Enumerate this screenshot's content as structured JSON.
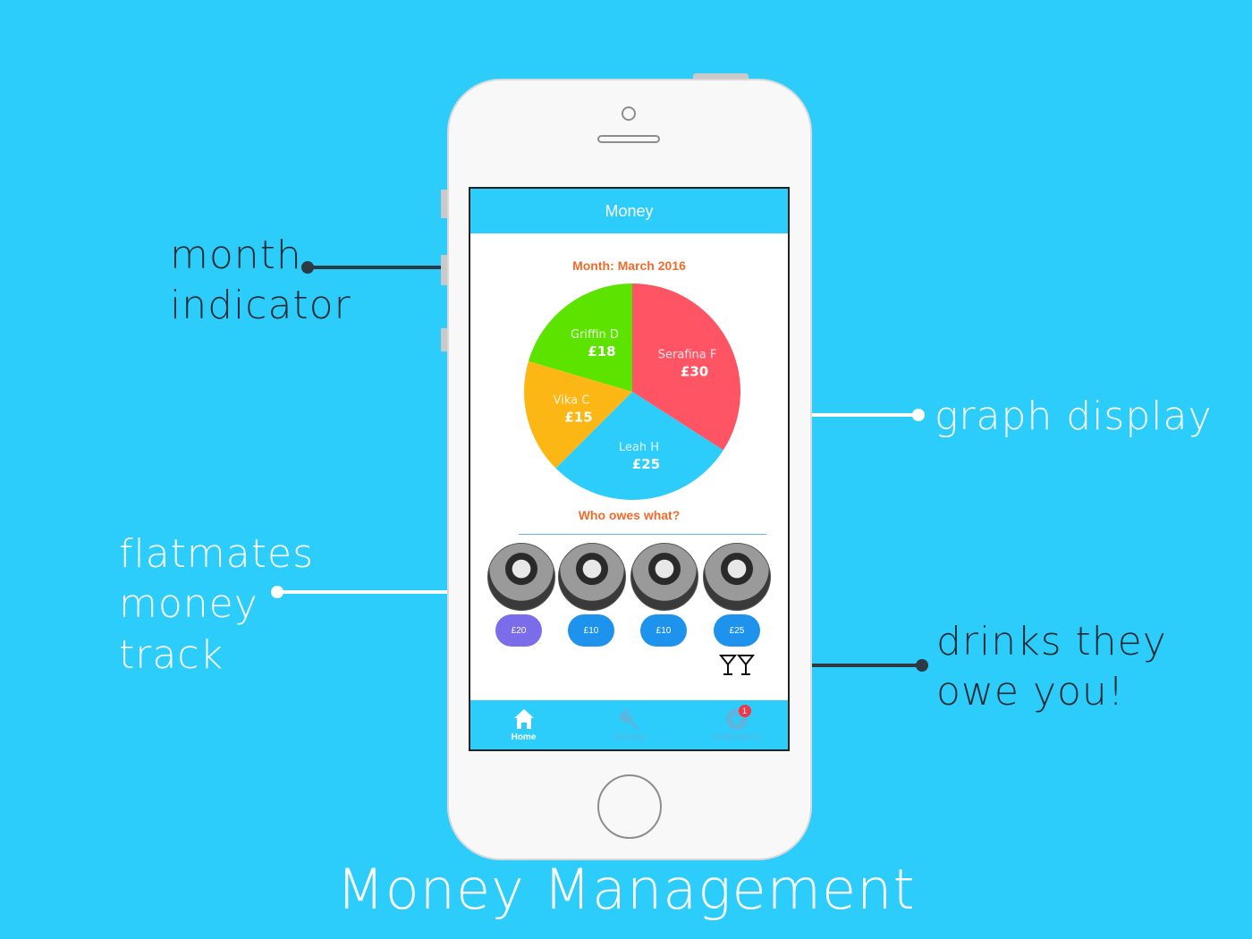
{
  "annotations": {
    "month": [
      "month",
      "indicator"
    ],
    "graph": "graph display",
    "flatmates": [
      "flatmates",
      "money",
      "track"
    ],
    "drinks": [
      "drinks they",
      "owe you!"
    ]
  },
  "caption": "Money Management",
  "app": {
    "title": "Money",
    "month_label": "Month: March 2016",
    "section_title": "Who owes what?",
    "flatmates": [
      {
        "amount": "£20",
        "color": "#7b6cea"
      },
      {
        "amount": "£10",
        "color": "#1d93ee"
      },
      {
        "amount": "£10",
        "color": "#1d93ee"
      },
      {
        "amount": "£25",
        "color": "#1d93ee"
      }
    ],
    "tabs": [
      {
        "label": "Home",
        "icon": "home-icon",
        "active": true
      },
      {
        "label": "Settings",
        "icon": "wrench-icon",
        "active": false
      },
      {
        "label": "Notifications",
        "icon": "star-icon",
        "active": false,
        "badge": "1"
      }
    ]
  },
  "chart_data": {
    "type": "pie",
    "title": "",
    "slices": [
      {
        "label": "Serafina F",
        "value_label": "£30",
        "value": 30,
        "color": "#fe5464"
      },
      {
        "label": "Leah H",
        "value_label": "£25",
        "value": 25,
        "color": "#2ccdfb"
      },
      {
        "label": "Vika C",
        "value_label": "£15",
        "value": 15,
        "color": "#fdb714"
      },
      {
        "label": "Griffin D",
        "value_label": "£18",
        "value": 18,
        "color": "#5ce300"
      }
    ]
  },
  "colors": {
    "background": "#2ccdfb",
    "accent_orange": "#f36b2b",
    "annotation_dark": "#1f2a33"
  }
}
